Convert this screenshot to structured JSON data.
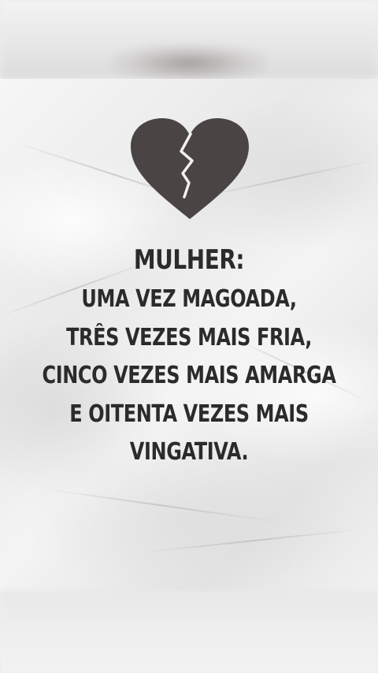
{
  "quote": {
    "title": "MULHER:",
    "lines": [
      "UMA VEZ MAGOADA,",
      "TRÊS VEZES MAIS FRIA,",
      "CINCO VEZES MAIS AMARGA",
      "E OITENTA VEZES MAIS",
      "VINGATIVA."
    ]
  },
  "colors": {
    "text": "#2b2b2b",
    "heart": "#4a4444",
    "paper": "#efefef"
  },
  "icons": {
    "heart": "broken-heart-icon"
  }
}
